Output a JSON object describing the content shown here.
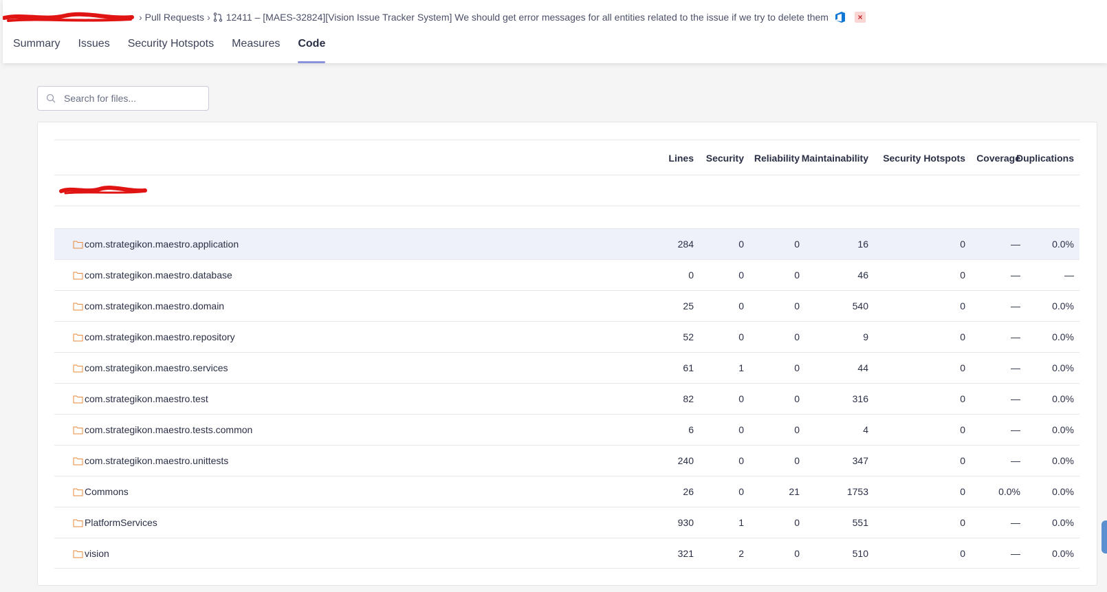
{
  "breadcrumb": {
    "separator": "›",
    "pull_requests": "Pull Requests",
    "pr_title": "12411 – [MAES-32824][Vision Issue Tracker System] We should get error messages for all entities related to the issue if we try to delete them",
    "close": "×"
  },
  "tabs": [
    {
      "label": "Summary",
      "active": false
    },
    {
      "label": "Issues",
      "active": false
    },
    {
      "label": "Security Hotspots",
      "active": false
    },
    {
      "label": "Measures",
      "active": false
    },
    {
      "label": "Code",
      "active": true
    }
  ],
  "search": {
    "placeholder": "Search for files..."
  },
  "table": {
    "headers": [
      "Lines",
      "Security",
      "Reliability",
      "Maintainability",
      "Security Hotspots",
      "Coverage",
      "Duplications"
    ],
    "rows": [
      {
        "name": "com.strategikon.maestro.application",
        "lines": "284",
        "security": "0",
        "reliability": "0",
        "maintainability": "16",
        "hotspots": "0",
        "coverage": "—",
        "duplications": "0.0%"
      },
      {
        "name": "com.strategikon.maestro.database",
        "lines": "0",
        "security": "0",
        "reliability": "0",
        "maintainability": "46",
        "hotspots": "0",
        "coverage": "—",
        "duplications": "—"
      },
      {
        "name": "com.strategikon.maestro.domain",
        "lines": "25",
        "security": "0",
        "reliability": "0",
        "maintainability": "540",
        "hotspots": "0",
        "coverage": "—",
        "duplications": "0.0%"
      },
      {
        "name": "com.strategikon.maestro.repository",
        "lines": "52",
        "security": "0",
        "reliability": "0",
        "maintainability": "9",
        "hotspots": "0",
        "coverage": "—",
        "duplications": "0.0%"
      },
      {
        "name": "com.strategikon.maestro.services",
        "lines": "61",
        "security": "1",
        "reliability": "0",
        "maintainability": "44",
        "hotspots": "0",
        "coverage": "—",
        "duplications": "0.0%"
      },
      {
        "name": "com.strategikon.maestro.test",
        "lines": "82",
        "security": "0",
        "reliability": "0",
        "maintainability": "316",
        "hotspots": "0",
        "coverage": "—",
        "duplications": "0.0%"
      },
      {
        "name": "com.strategikon.maestro.tests.common",
        "lines": "6",
        "security": "0",
        "reliability": "0",
        "maintainability": "4",
        "hotspots": "0",
        "coverage": "—",
        "duplications": "0.0%"
      },
      {
        "name": "com.strategikon.maestro.unittests",
        "lines": "240",
        "security": "0",
        "reliability": "0",
        "maintainability": "347",
        "hotspots": "0",
        "coverage": "—",
        "duplications": "0.0%"
      },
      {
        "name": "Commons",
        "lines": "26",
        "security": "0",
        "reliability": "21",
        "maintainability": "1753",
        "hotspots": "0",
        "coverage": "0.0%",
        "duplications": "0.0%"
      },
      {
        "name": "PlatformServices",
        "lines": "930",
        "security": "1",
        "reliability": "0",
        "maintainability": "551",
        "hotspots": "0",
        "coverage": "—",
        "duplications": "0.0%"
      },
      {
        "name": "vision",
        "lines": "321",
        "security": "2",
        "reliability": "0",
        "maintainability": "510",
        "hotspots": "0",
        "coverage": "—",
        "duplications": "0.0%"
      }
    ]
  },
  "colors": {
    "accent": "#8993d9",
    "folder": "#e8893a",
    "azure": "#0f78d4",
    "highlight_row": "#eef0fa"
  }
}
